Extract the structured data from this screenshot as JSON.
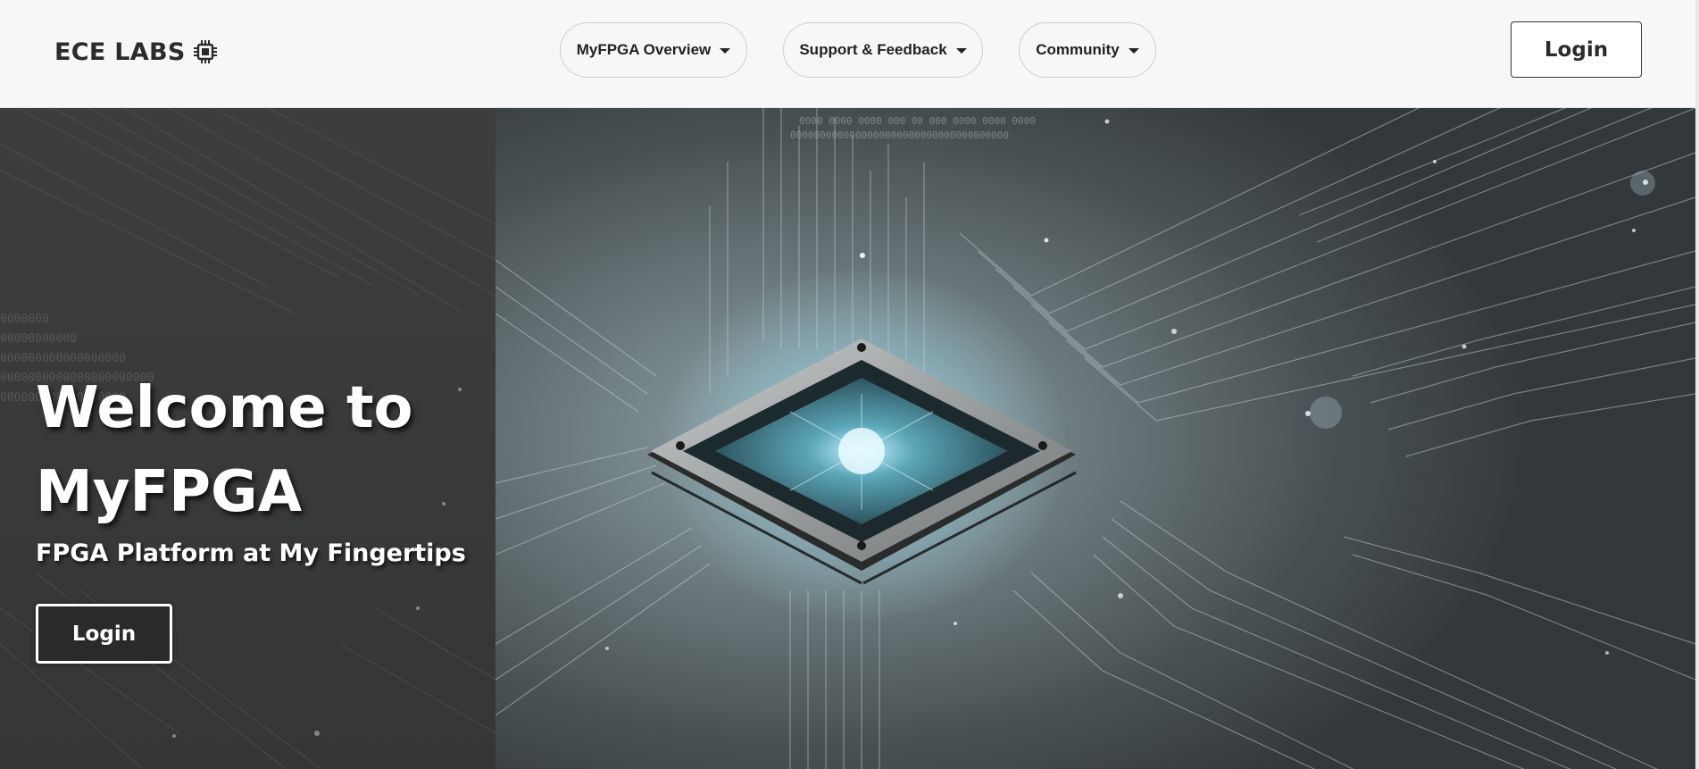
{
  "brand": {
    "name": "ECE LABS",
    "icon": "chip-icon"
  },
  "nav": {
    "items": [
      {
        "label": "MyFPGA Overview",
        "icon": "caret-down-icon"
      },
      {
        "label": "Support & Feedback",
        "icon": "caret-down-icon"
      },
      {
        "label": "Community",
        "icon": "caret-down-icon"
      }
    ],
    "login_label": "Login"
  },
  "hero": {
    "title_line1": "Welcome to",
    "title_line2": "MyFPGA",
    "subtitle": "FPGA Platform at My Fingertips",
    "login_label": "Login",
    "image": "fpga-chip-circuit-illustration"
  },
  "colors": {
    "navbar_bg": "#f7f7f7",
    "hero_left_bg": "#3a3b39",
    "glow": "#bfe9f5",
    "text_dark": "#2b2b2b"
  }
}
